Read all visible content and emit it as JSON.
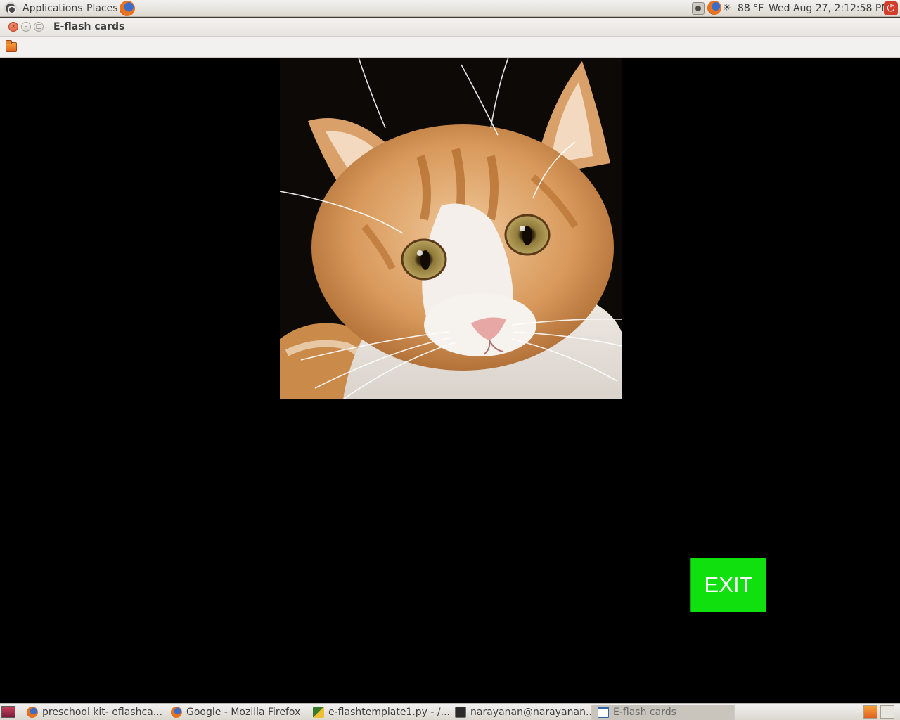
{
  "top_panel": {
    "menus": [
      "Applications",
      "Places"
    ],
    "weather": "88 °F",
    "clock": "Wed Aug 27,  2:12:58 PM"
  },
  "window": {
    "title": "E-flash cards"
  },
  "flash_card": {
    "image_subject": "orange-and-white cat",
    "exit_label": "EXIT",
    "exit_color": "#10e00e"
  },
  "taskbar": {
    "tasks": [
      {
        "label": "preschool kit- eflashca...",
        "icon": "firefox-icon"
      },
      {
        "label": "Google - Mozilla Firefox",
        "icon": "firefox-icon"
      },
      {
        "label": "e-flashtemplate1.py - /...",
        "icon": "python-editor-icon"
      },
      {
        "label": "narayanan@narayanan...",
        "icon": "terminal-icon"
      },
      {
        "label": "E-flash cards",
        "icon": "window-icon"
      }
    ]
  }
}
